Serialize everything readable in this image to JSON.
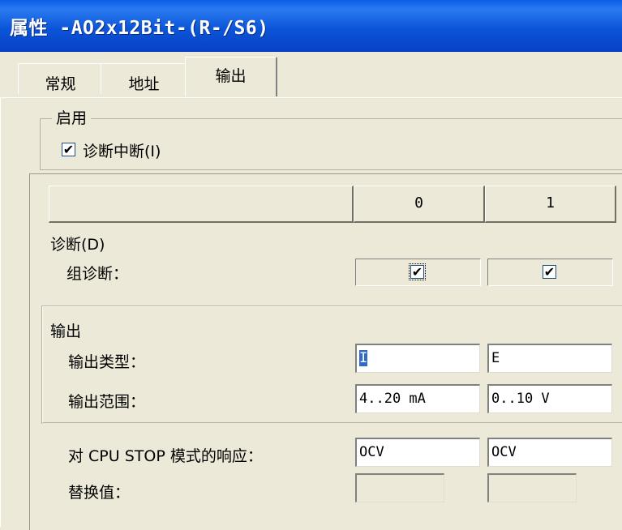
{
  "window": {
    "title": "属性 -AO2x12Bit-(R-/S6)"
  },
  "tabs": [
    {
      "label": "常规"
    },
    {
      "label": "地址"
    },
    {
      "label": "输出"
    }
  ],
  "enable_group": {
    "legend": "启用",
    "diag_interrupt": {
      "label": "诊断中断(I)",
      "checked": true,
      "mark": "✔"
    }
  },
  "table": {
    "channels": [
      "0",
      "1"
    ],
    "diagnosis": {
      "heading": "诊断(D)",
      "group_diag_label": "组诊断：",
      "group_diag_checked": [
        true,
        true
      ],
      "marks": [
        "✔",
        "✔"
      ]
    },
    "output": {
      "heading": "输出",
      "type_label": "输出类型：",
      "type_values": [
        "I",
        "E"
      ],
      "range_label": "输出范围：",
      "range_values": [
        "4..20 mA",
        "0..10 V"
      ]
    },
    "cpu_stop_label": "对 CPU STOP 模式的响应：",
    "cpu_stop_values": [
      "OCV",
      "OCV"
    ],
    "substitute_label": "替换值：",
    "substitute_values": [
      "",
      ""
    ]
  }
}
